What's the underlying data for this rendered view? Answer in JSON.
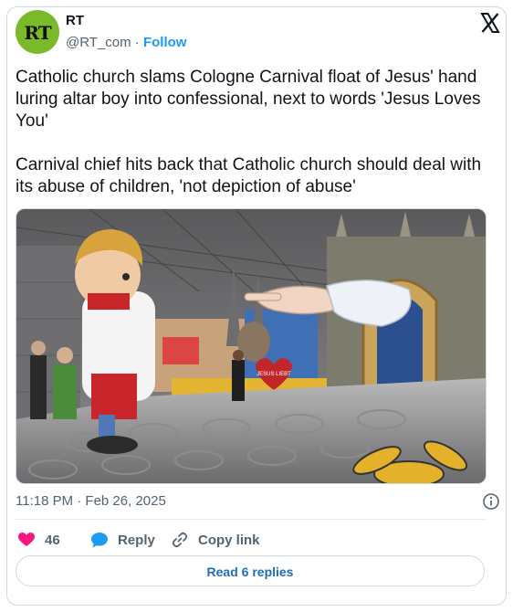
{
  "author": {
    "avatar_text": "RT",
    "name": "RT",
    "handle": "@RT_com",
    "separator": " · ",
    "follow_label": "Follow"
  },
  "post": {
    "text": "Catholic church slams Cologne Carnival float of Jesus' hand luring altar boy into confessional, next to words 'Jesus Loves You'\n\nCarnival chief hits back that Catholic church should deal with its abuse of children, 'not depiction of abuse'",
    "timestamp": "11:18 PM · Feb 26, 2025"
  },
  "media": {
    "heart_label": "JESUS LIEBT"
  },
  "actions": {
    "like_count": "46",
    "reply_label": "Reply",
    "copy_link_label": "Copy link"
  },
  "footer": {
    "read_replies_label": "Read 6 replies"
  },
  "colors": {
    "accent": "#1d9bf0",
    "like": "#f91880",
    "avatar_bg": "#7ab929"
  },
  "icons": [
    "x-logo-icon",
    "info-icon",
    "heart-icon",
    "reply-bubble-icon",
    "link-icon"
  ]
}
